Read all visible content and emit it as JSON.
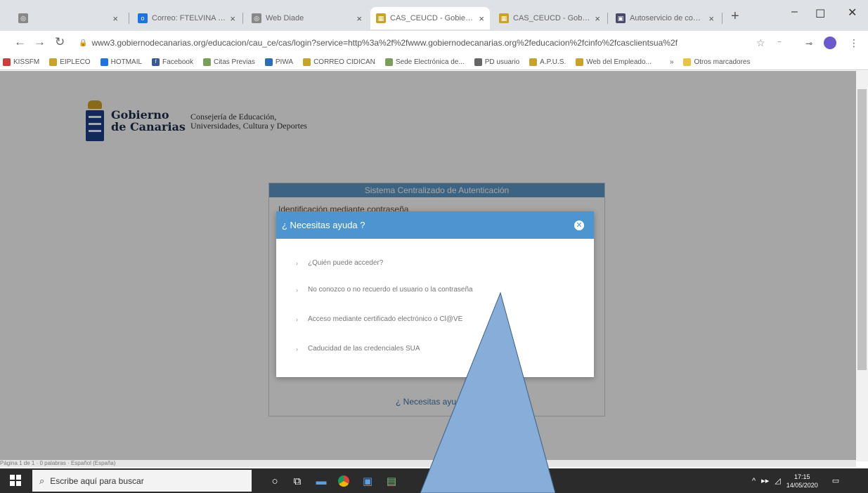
{
  "browser": {
    "tabs": [
      {
        "title": "",
        "icon": "globe-icon",
        "active": false
      },
      {
        "title": "Correo: FTELVINA BECT",
        "icon": "outlook-icon",
        "active": false
      },
      {
        "title": "Web Diade",
        "icon": "globe-icon",
        "active": false
      },
      {
        "title": "CAS_CEUCD - Gobierno",
        "icon": "gobierno-icon",
        "active": true
      },
      {
        "title": "CAS_CEUCD - Gobierno",
        "icon": "gobierno-icon",
        "active": false
      },
      {
        "title": "Autoservicio de contra",
        "icon": "autoservicio-icon",
        "active": false
      }
    ],
    "url": "www3.gobiernodecanarias.org/educacion/cau_ce/cas/login?service=http%3a%2f%2fwww.gobiernodecanarias.org%2feducacion%2fcinfo%2fcasclientsua%2f",
    "bookmarks": [
      {
        "label": "KISSFM",
        "color": "#d33a3a"
      },
      {
        "label": "EIPLECO",
        "color": "#c9a227"
      },
      {
        "label": "HOTMAIL",
        "color": "#1a73e8"
      },
      {
        "label": "Facebook",
        "color": "#3b5998"
      },
      {
        "label": "Citas Previas",
        "color": "#7a9f5a"
      },
      {
        "label": "PIWA",
        "color": "#2a6ebb"
      },
      {
        "label": "CORREO CIDICAN",
        "color": "#c9a227"
      },
      {
        "label": "Sede Electrónica de...",
        "color": "#7a9f5a"
      },
      {
        "label": "PD usuario",
        "color": "#666666"
      },
      {
        "label": "A.P.U.S.",
        "color": "#c9a227"
      },
      {
        "label": "Web del Empleado...",
        "color": "#c9a227"
      }
    ],
    "bookmarks_more": "»",
    "other_bookmarks": "Otros marcadores"
  },
  "page": {
    "logo_line1": "Gobierno",
    "logo_line2": "de Canarias",
    "consejeria_line1": "Consejería de Educación,",
    "consejeria_line2": "Universidades, Cultura y Deportes",
    "auth_title": "Sistema Centralizado de Autenticación",
    "auth_subtitle": "Identificación mediante contraseña",
    "auth_help": "¿ Necesitas ayuda ?",
    "status_strip": "Página 1 de 1   ·   0 palabras   ·   Español (España)"
  },
  "modal": {
    "title": "¿ Necesitas ayuda ?",
    "close_glyph": "✕",
    "items": [
      "¿Quién puede acceder?",
      "No conozco o no recuerdo el usuario o la contraseña",
      "Acceso mediante certificado electrónico o Cl@VE",
      "Caducidad de las credenciales SUA"
    ]
  },
  "taskbar": {
    "search_placeholder": "Escribe aquí para buscar",
    "time": "17:15",
    "date": "14/05/2020"
  },
  "colors": {
    "modal_header": "#4c95d1",
    "auth_header": "#5c9ac8",
    "arrow_fill": "#86aed8",
    "arrow_stroke": "#3d5f86"
  }
}
